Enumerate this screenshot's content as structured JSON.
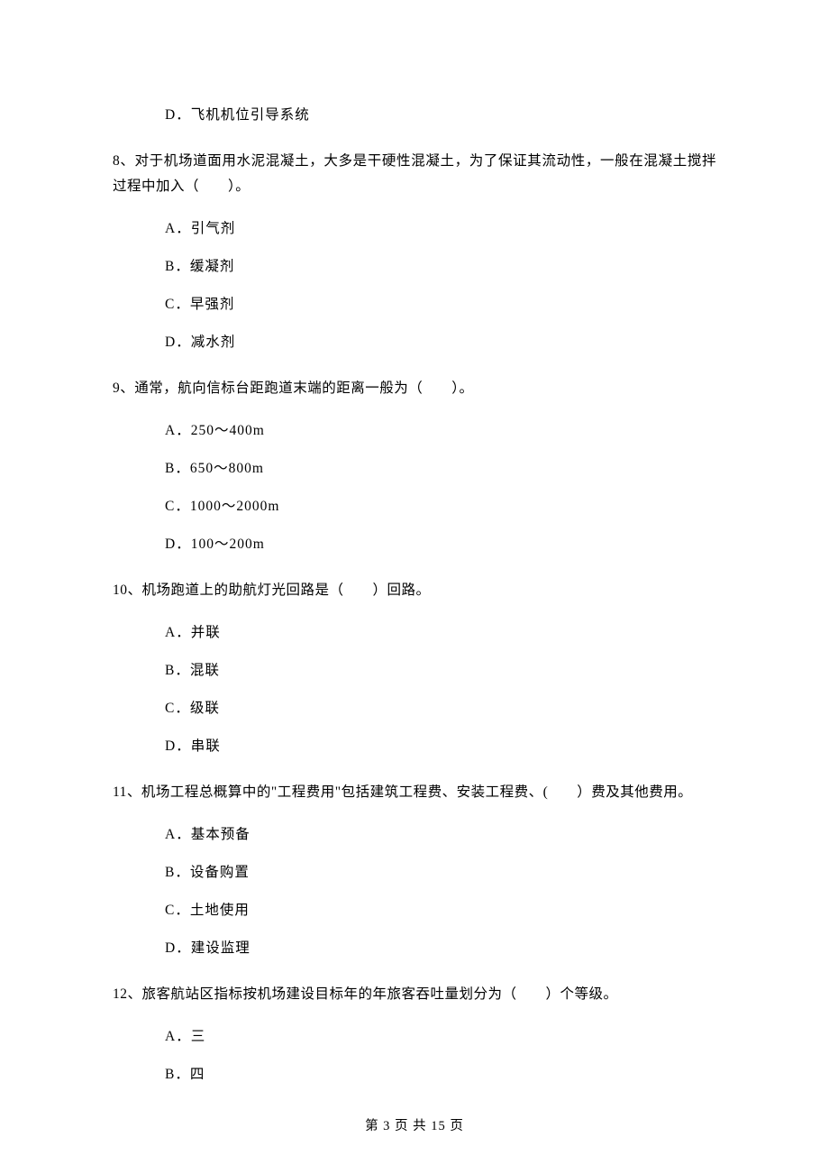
{
  "q7": {
    "d": "D．飞机机位引导系统"
  },
  "q8": {
    "stem": "8、对于机场道面用水泥混凝土，大多是干硬性混凝土，为了保证其流动性，一般在混凝土搅拌过程中加入（　　）。",
    "a": "A．引气剂",
    "b": "B．缓凝剂",
    "c": "C．早强剂",
    "d": "D．减水剂"
  },
  "q9": {
    "stem": "9、通常，航向信标台距跑道末端的距离一般为（　　）。",
    "a": "A．250～400m",
    "b": "B．650～800m",
    "c": "C．1000～2000m",
    "d": "D．100～200m"
  },
  "q10": {
    "stem": "10、机场跑道上的助航灯光回路是（　　）回路。",
    "a": "A．并联",
    "b": "B．混联",
    "c": "C．级联",
    "d": "D．串联"
  },
  "q11": {
    "stem": "11、机场工程总概算中的\"工程费用\"包括建筑工程费、安装工程费、(　　）费及其他费用。",
    "a": "A．基本预备",
    "b": "B．设备购置",
    "c": "C．土地使用",
    "d": "D．建设监理"
  },
  "q12": {
    "stem": "12、旅客航站区指标按机场建设目标年的年旅客吞吐量划分为（　　）个等级。",
    "a": "A．三",
    "b": "B．四"
  },
  "footer": "第 3 页 共 15 页"
}
